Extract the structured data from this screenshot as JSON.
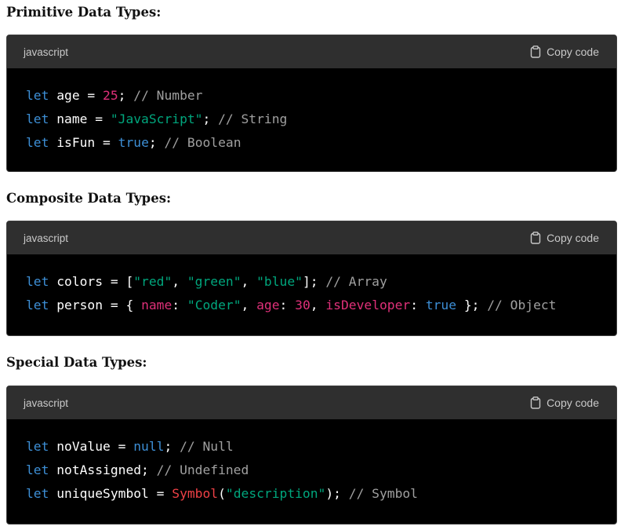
{
  "sections": [
    {
      "title": "Primitive Data Types:",
      "language": "javascript",
      "copy_label": "Copy code",
      "lines": [
        [
          {
            "t": "let",
            "c": "keyword"
          },
          {
            "t": " age = ",
            "c": "ident"
          },
          {
            "t": "25",
            "c": "number"
          },
          {
            "t": "; ",
            "c": "punct"
          },
          {
            "t": "// Number",
            "c": "comment"
          }
        ],
        [
          {
            "t": "let",
            "c": "keyword"
          },
          {
            "t": " name = ",
            "c": "ident"
          },
          {
            "t": "\"JavaScript\"",
            "c": "string"
          },
          {
            "t": "; ",
            "c": "punct"
          },
          {
            "t": "// String",
            "c": "comment"
          }
        ],
        [
          {
            "t": "let",
            "c": "keyword"
          },
          {
            "t": " isFun = ",
            "c": "ident"
          },
          {
            "t": "true",
            "c": "boolean"
          },
          {
            "t": "; ",
            "c": "punct"
          },
          {
            "t": "// Boolean",
            "c": "comment"
          }
        ]
      ]
    },
    {
      "title": "Composite Data Types:",
      "language": "javascript",
      "copy_label": "Copy code",
      "lines": [
        [
          {
            "t": "let",
            "c": "keyword"
          },
          {
            "t": " colors = [",
            "c": "ident"
          },
          {
            "t": "\"red\"",
            "c": "string"
          },
          {
            "t": ", ",
            "c": "punct"
          },
          {
            "t": "\"green\"",
            "c": "string"
          },
          {
            "t": ", ",
            "c": "punct"
          },
          {
            "t": "\"blue\"",
            "c": "string"
          },
          {
            "t": "]; ",
            "c": "punct"
          },
          {
            "t": "// Array",
            "c": "comment"
          }
        ],
        [
          {
            "t": "let",
            "c": "keyword"
          },
          {
            "t": " person = { ",
            "c": "ident"
          },
          {
            "t": "name",
            "c": "prop"
          },
          {
            "t": ": ",
            "c": "punct"
          },
          {
            "t": "\"Coder\"",
            "c": "string"
          },
          {
            "t": ", ",
            "c": "punct"
          },
          {
            "t": "age",
            "c": "prop"
          },
          {
            "t": ": ",
            "c": "punct"
          },
          {
            "t": "30",
            "c": "number"
          },
          {
            "t": ", ",
            "c": "punct"
          },
          {
            "t": "isDeveloper",
            "c": "prop"
          },
          {
            "t": ": ",
            "c": "punct"
          },
          {
            "t": "true",
            "c": "boolean"
          },
          {
            "t": " }; ",
            "c": "punct"
          },
          {
            "t": "// Object",
            "c": "comment"
          }
        ]
      ]
    },
    {
      "title": "Special Data Types:",
      "language": "javascript",
      "copy_label": "Copy code",
      "lines": [
        [
          {
            "t": "let",
            "c": "keyword"
          },
          {
            "t": " noValue = ",
            "c": "ident"
          },
          {
            "t": "null",
            "c": "null"
          },
          {
            "t": "; ",
            "c": "punct"
          },
          {
            "t": "// Null",
            "c": "comment"
          }
        ],
        [
          {
            "t": "let",
            "c": "keyword"
          },
          {
            "t": " notAssigned; ",
            "c": "ident"
          },
          {
            "t": "// Undefined",
            "c": "comment"
          }
        ],
        [
          {
            "t": "let",
            "c": "keyword"
          },
          {
            "t": " uniqueSymbol = ",
            "c": "ident"
          },
          {
            "t": "Symbol",
            "c": "func"
          },
          {
            "t": "(",
            "c": "punct"
          },
          {
            "t": "\"description\"",
            "c": "string"
          },
          {
            "t": "); ",
            "c": "punct"
          },
          {
            "t": "// Symbol",
            "c": "comment"
          }
        ]
      ]
    }
  ],
  "icons": {
    "copy": "clipboard-icon"
  },
  "colors": {
    "keyword": "#3d8fd6",
    "string": "#00a67d",
    "number": "#df3079",
    "comment": "#a0a0a0",
    "function": "#ef4146",
    "header_bg": "#2f2f2f",
    "code_bg": "#000000"
  }
}
